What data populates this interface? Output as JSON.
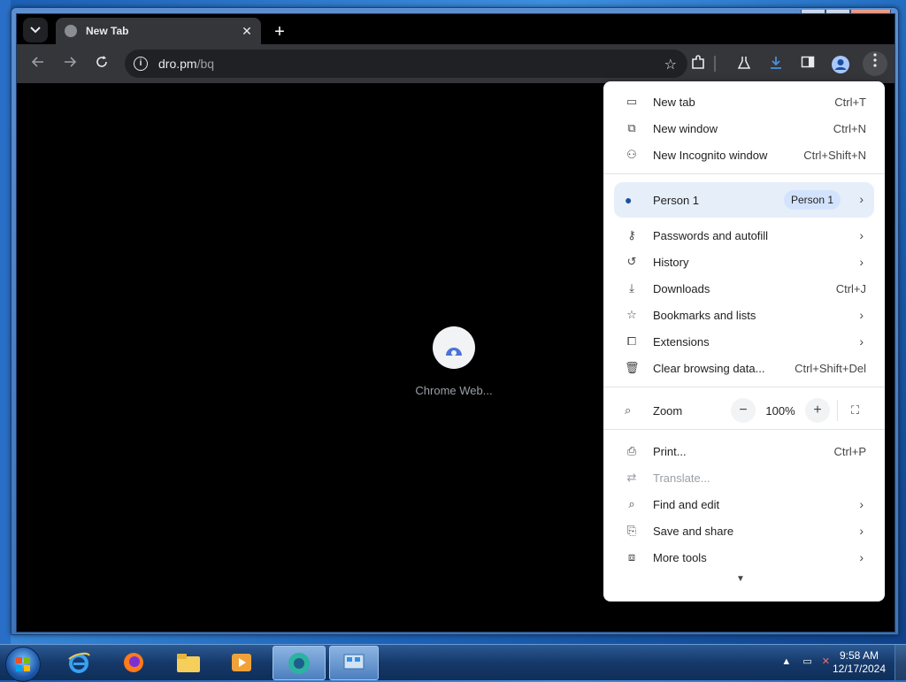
{
  "browser": {
    "tab_title": "New Tab",
    "tab_close": "✕",
    "new_tab_symbol": "+",
    "url_host": "dro.pm",
    "url_path": "/bq",
    "loading_label": "Chrome Web..."
  },
  "menu": {
    "items_top": [
      {
        "label": "New tab",
        "shortcut": "Ctrl+T",
        "icon": "new-tab-icon"
      },
      {
        "label": "New window",
        "shortcut": "Ctrl+N",
        "icon": "new-window-icon"
      },
      {
        "label": "New Incognito window",
        "shortcut": "Ctrl+Shift+N",
        "icon": "incognito-icon"
      }
    ],
    "person": {
      "label": "Person 1",
      "badge": "Person 1"
    },
    "items_mid": [
      {
        "label": "Passwords and autofill",
        "icon": "key-icon",
        "submenu": true
      },
      {
        "label": "History",
        "icon": "history-icon",
        "submenu": true
      },
      {
        "label": "Downloads",
        "shortcut": "Ctrl+J",
        "icon": "download-icon"
      },
      {
        "label": "Bookmarks and lists",
        "icon": "star-icon",
        "submenu": true
      },
      {
        "label": "Extensions",
        "icon": "puzzle-icon",
        "submenu": true
      },
      {
        "label": "Clear browsing data...",
        "shortcut": "Ctrl+Shift+Del",
        "icon": "trash-icon"
      }
    ],
    "zoom": {
      "label": "Zoom",
      "minus": "−",
      "value": "100%",
      "plus": "+"
    },
    "items_bottom": [
      {
        "label": "Print...",
        "shortcut": "Ctrl+P",
        "icon": "printer-icon"
      },
      {
        "label": "Translate...",
        "icon": "translate-icon",
        "disabled": true
      },
      {
        "label": "Find and edit",
        "icon": "find-icon",
        "submenu": true
      },
      {
        "label": "Save and share",
        "icon": "save-icon",
        "submenu": true
      },
      {
        "label": "More tools",
        "icon": "toolbox-icon",
        "submenu": true
      }
    ]
  },
  "taskbar": {
    "time": "9:58 AM",
    "date": "12/17/2024"
  }
}
